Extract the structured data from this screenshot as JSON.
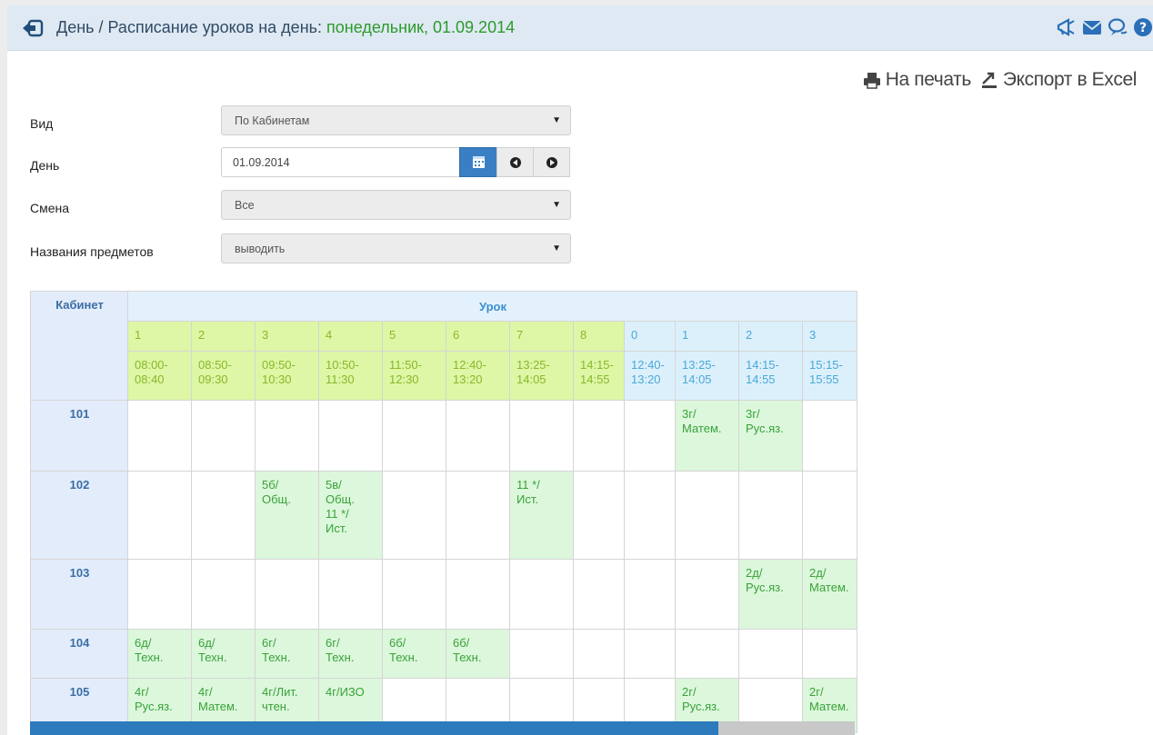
{
  "header": {
    "title_prefix": "День / Расписание уроков на день: ",
    "title_date": "понедельник, 01.09.2014",
    "icons": [
      "back-icon",
      "megaphone-icon",
      "envelope-icon",
      "chat-icon",
      "help-icon"
    ]
  },
  "actions": {
    "print_label": "На печать",
    "export_label": "Экспорт в Excel"
  },
  "form": {
    "view_label": "Вид",
    "view_value": "По Кабинетам",
    "day_label": "День",
    "day_value": "01.09.2014",
    "shift_label": "Смена",
    "shift_value": "Все",
    "subjects_label": "Названия предметов",
    "subjects_value": "выводить"
  },
  "table": {
    "room_header": "Кабинет",
    "lesson_header": "Урок",
    "lessons": [
      {
        "num": "1",
        "time1": "08:00-",
        "time2": "08:40",
        "shift": 1
      },
      {
        "num": "2",
        "time1": "08:50-",
        "time2": "09:30",
        "shift": 1
      },
      {
        "num": "3",
        "time1": "09:50-",
        "time2": "10:30",
        "shift": 1
      },
      {
        "num": "4",
        "time1": "10:50-",
        "time2": "11:30",
        "shift": 1
      },
      {
        "num": "5",
        "time1": "11:50-",
        "time2": "12:30",
        "shift": 1
      },
      {
        "num": "6",
        "time1": "12:40-",
        "time2": "13:20",
        "shift": 1
      },
      {
        "num": "7",
        "time1": "13:25-",
        "time2": "14:05",
        "shift": 1
      },
      {
        "num": "8",
        "time1": "14:15-",
        "time2": "14:55",
        "shift": 1
      },
      {
        "num": "0",
        "time1": "12:40-",
        "time2": "13:20",
        "shift": 2
      },
      {
        "num": "1",
        "time1": "13:25-",
        "time2": "14:05",
        "shift": 2
      },
      {
        "num": "2",
        "time1": "14:15-",
        "time2": "14:55",
        "shift": 2
      },
      {
        "num": "3",
        "time1": "15:15-",
        "time2": "15:55",
        "shift": 2
      }
    ],
    "rows": [
      {
        "room": "101",
        "cells": [
          [],
          [],
          [],
          [],
          [],
          [],
          [],
          [],
          [],
          [
            "3г/",
            "Матем."
          ],
          [
            "3г/",
            "Рус.яз."
          ],
          []
        ]
      },
      {
        "room": "102",
        "cells": [
          [],
          [],
          [
            "5б/",
            "Общ."
          ],
          [
            "5в/",
            "Общ.",
            "11 */",
            "Ист."
          ],
          [],
          [],
          [
            "11 */",
            "Ист."
          ],
          [],
          [],
          [],
          [],
          []
        ]
      },
      {
        "room": "103",
        "cells": [
          [],
          [],
          [],
          [],
          [],
          [],
          [],
          [],
          [],
          [],
          [
            "2д/",
            "Рус.яз."
          ],
          [
            "2д/",
            "Матем."
          ]
        ]
      },
      {
        "room": "104",
        "cells": [
          [
            "6д/",
            "Техн."
          ],
          [
            "6д/",
            "Техн."
          ],
          [
            "6г/",
            "Техн."
          ],
          [
            "6г/",
            "Техн."
          ],
          [
            "6б/",
            "Техн."
          ],
          [
            "6б/",
            "Техн."
          ],
          [],
          [],
          [],
          [],
          [],
          []
        ]
      },
      {
        "room": "105",
        "cells": [
          [
            "4г/",
            "Рус.яз."
          ],
          [
            "4г/",
            "Матем."
          ],
          [
            "4г/Лит.",
            "чтен."
          ],
          [
            "4г/ИЗО"
          ],
          [],
          [],
          [],
          [],
          [],
          [
            "2г/",
            "Рус.яз."
          ],
          [],
          [
            "2г/",
            "Матем."
          ]
        ]
      }
    ]
  }
}
